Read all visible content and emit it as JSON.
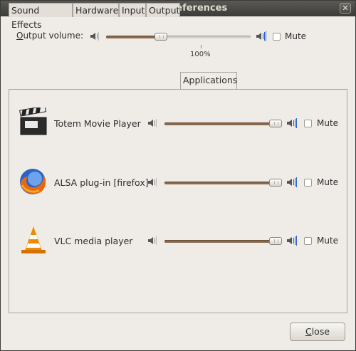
{
  "window": {
    "title": "Sound Preferences",
    "close_glyph": "✕"
  },
  "output": {
    "label_mnemonic": "O",
    "label_rest": "utput volume:",
    "volume_percent_label": "100%",
    "volume_fraction": 0.38,
    "mute_label": "Mute",
    "mute_checked": false
  },
  "tabs": [
    {
      "label": "Sound Effects",
      "active": false
    },
    {
      "label": "Hardware",
      "active": false
    },
    {
      "label": "Input",
      "active": false
    },
    {
      "label": "Output",
      "active": false
    },
    {
      "label": "Applications",
      "active": true
    }
  ],
  "apps": [
    {
      "name": "Totem Movie Player",
      "icon": "clapperboard-icon",
      "volume_fraction": 1.0,
      "mute_label": "Mute",
      "mute_checked": false
    },
    {
      "name": "ALSA plug-in [firefox]",
      "icon": "firefox-icon",
      "volume_fraction": 1.0,
      "mute_label": "Mute",
      "mute_checked": false
    },
    {
      "name": "VLC media player",
      "icon": "vlc-cone-icon",
      "volume_fraction": 1.0,
      "mute_label": "Mute",
      "mute_checked": false
    }
  ],
  "footer": {
    "close_mnemonic": "C",
    "close_rest": "lose"
  },
  "colors": {
    "titlebar": "#3c3b37",
    "slider_fill": "#8b6a4e",
    "window_bg": "#efebe7"
  }
}
